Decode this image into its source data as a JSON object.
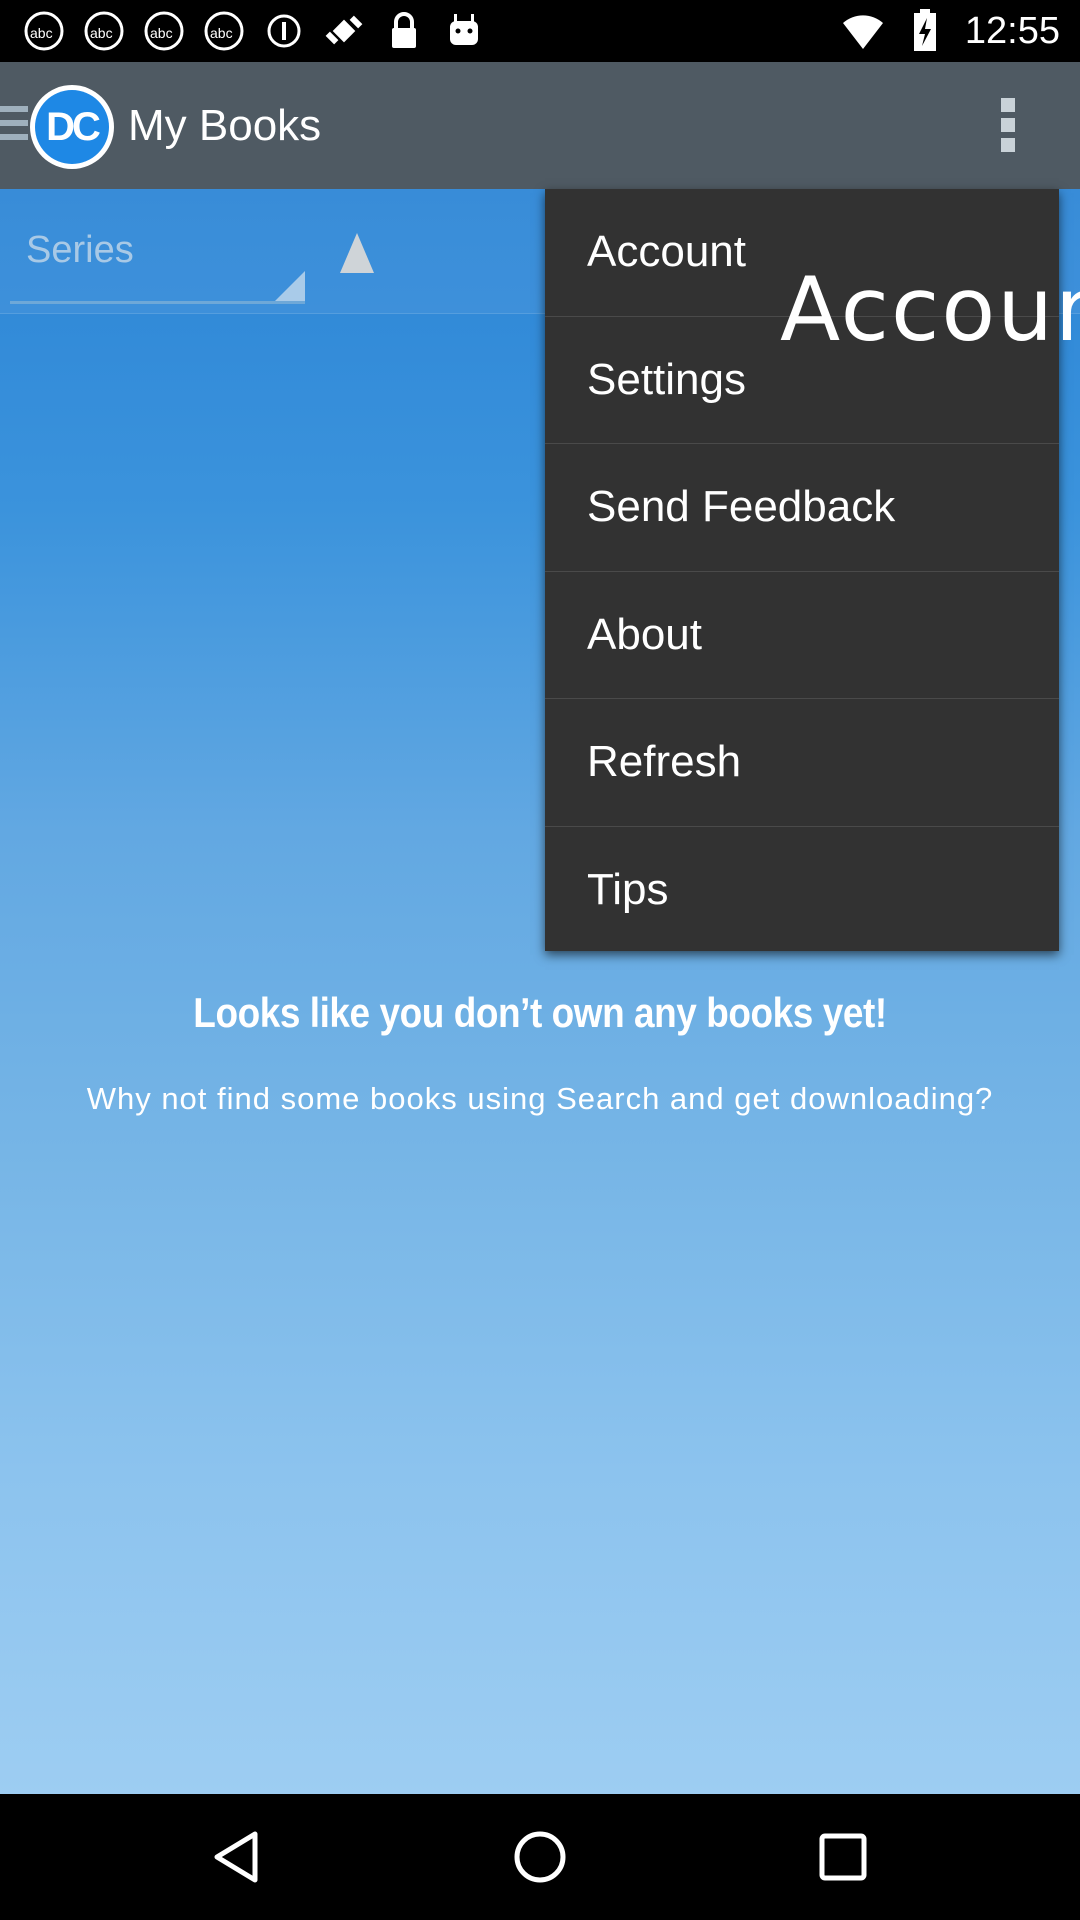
{
  "status_bar": {
    "time": "12:55",
    "left_icons": [
      "abc7-icon",
      "abc7-icon",
      "abc7-icon",
      "abc7-icon",
      "info-circle-icon",
      "fake-gps-icon",
      "lock-icon",
      "android-icon"
    ],
    "right_icons": [
      "wifi-icon",
      "battery-charging-icon"
    ]
  },
  "app_bar": {
    "logo_text": "DC",
    "title": "My Books"
  },
  "filter": {
    "spinner_label": "Series"
  },
  "empty_state": {
    "title": "Looks like you don’t own any books yet!",
    "subtitle": "Why not find some books using Search and get downloading?"
  },
  "overflow_menu": {
    "items": [
      {
        "label": "Account"
      },
      {
        "label": "Settings"
      },
      {
        "label": "Send Feedback"
      },
      {
        "label": "About"
      },
      {
        "label": "Refresh"
      },
      {
        "label": "Tips"
      }
    ]
  },
  "overlay_text": "Accoun",
  "colors": {
    "app_bar": "#4f5a63",
    "menu_bg": "#323232",
    "content_top": "#2c85d6",
    "content_bottom": "#9dcdf2"
  }
}
